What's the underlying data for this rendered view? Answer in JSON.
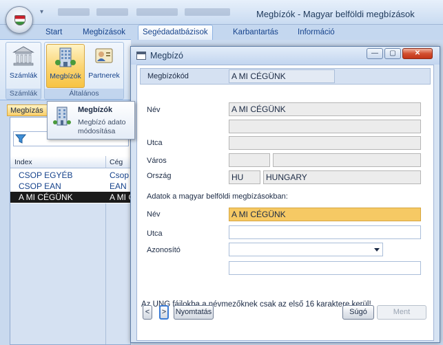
{
  "app": {
    "title": "Megbízók - Magyar belföldi megbízások",
    "orb_icon": "hungarian-flag-shield-icon",
    "qat_arrow": "▾"
  },
  "ribbon": {
    "tabs": [
      "Start",
      "Megbízások",
      "Segédadatbázisok",
      "Karbantartás",
      "Információ"
    ],
    "active_tab": "Segédadatbázisok",
    "groups": [
      {
        "label": "Számlák",
        "buttons": [
          {
            "label": "Számlák",
            "icon": "bank-building-icon"
          }
        ]
      },
      {
        "label": "Általános",
        "buttons": [
          {
            "label": "Megbízók",
            "icon": "office-building-icon"
          },
          {
            "label": "Partnerek",
            "icon": "contact-card-icon"
          }
        ]
      }
    ]
  },
  "tooltip": {
    "title": "Megbízók",
    "body": "Megbízó adato módosítása"
  },
  "left_panel": {
    "doc_tab": "Megbízás",
    "filter_icon": "funnel-filter-icon",
    "columns": [
      "Index",
      "Cég"
    ],
    "rows": [
      {
        "index": "CSOP EGYÉB",
        "ceg": "Csop",
        "selected": false
      },
      {
        "index": "CSOP EAN",
        "ceg": "EAN",
        "selected": false
      },
      {
        "index": "A MI CÉGÜNK",
        "ceg": "A MI C",
        "selected": true
      }
    ]
  },
  "dialog": {
    "title": "Megbízó",
    "window_buttons": {
      "minimize": "—",
      "maximize": "▢",
      "close": "✕"
    },
    "megbizokod_label": "Megbízókód",
    "megbizokod_value": "A MI CÉGÜNK",
    "nev_label": "Név",
    "nev_value": "A MI CÉGÜNK",
    "nev2_value": "",
    "utca_label": "Utca",
    "utca_value": "",
    "varos_label": "Város",
    "irsz_value": "",
    "varos_value": "",
    "orszag_label": "Ország",
    "orszag_code": "HU",
    "orszag_name": "HUNGARY",
    "section_label": "Adatok a magyar belföldi megbízásokban:",
    "mb_nev_label": "Név",
    "mb_nev_value": "A MI CÉGÜNK",
    "mb_utca_label": "Utca",
    "mb_utca_value": "",
    "azonosito_label": "Azonosító",
    "azonosito_value": "",
    "extra_value": "",
    "note": "Az UNG fájlokba a névmezőknek csak az első 16 karaktere kerül!",
    "buttons": {
      "prev": "<",
      "next": ">",
      "print": "Nyomtatás",
      "help": "Súgó",
      "save": "Ment"
    }
  },
  "colors": {
    "accent_orange": "#f6c964",
    "selection": "#1a1a1a",
    "ribbon_blue": "#c4d7ef"
  }
}
